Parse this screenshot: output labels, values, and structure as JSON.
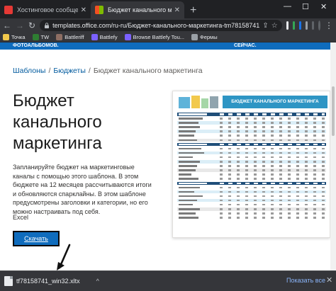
{
  "tabs": [
    {
      "title": "Хостинговое сообщество «Тим",
      "favicon_color": "#e53935",
      "active": false
    },
    {
      "title": "Бюджет канального маркетинг",
      "favicon_color": "#f25022",
      "active": true
    }
  ],
  "window": {
    "minimize": "—",
    "maximize": "☐",
    "close": "✕",
    "new_tab": "+"
  },
  "toolbar": {
    "back": "←",
    "forward": "→",
    "reload": "↻",
    "url": "templates.office.com/ru-ru/Бюджет-канального-маркетинга-tm78158741",
    "share": "⇪",
    "star": "☆",
    "menu": "⋮"
  },
  "bookmarks": [
    {
      "label": "Точка",
      "color": "#f2c94c"
    },
    {
      "label": "TW",
      "color": "#2e7d32"
    },
    {
      "label": "Battleriff",
      "color": "#8d6e63"
    },
    {
      "label": "Battlefy",
      "color": "#7b61ff"
    },
    {
      "label": "Browse Battlefy Tou...",
      "color": "#7b61ff"
    },
    {
      "label": "Фермы",
      "color": "#9aa0a6"
    }
  ],
  "banner": {
    "left": "ФОТОАЛЬБОМОВ.",
    "right": "СЕЙЧАС."
  },
  "breadcrumb": {
    "items": [
      "Шаблоны",
      "Бюджеты",
      "Бюджет канального маркетинга"
    ],
    "sep": "/"
  },
  "template": {
    "title": "Бюджет канального маркетинга",
    "description": "Запланируйте бюджет на маркетинговые каналы с помощью этого шаблона. В этом бюджете на 12 месяцев рассчитываются итоги и обновляются спарклайны. В этом шаблоне предусмотрены заголовки и категории, но его можно настраивать под себя.",
    "app": "Excel",
    "download_label": "Скачать",
    "preview_title": "БЮДЖЕТ КАНАЛЬНОГО МАРКЕТИНГА"
  },
  "download_bar": {
    "filename": "tf78158741_win32.xltx",
    "caret": "^",
    "show_all": "Показать все",
    "close": "✕"
  },
  "colors": {
    "accent": "#0f6cbd",
    "chrome_dark": "#202124",
    "chrome_toolbar": "#35363a",
    "link": "#005a9e"
  }
}
